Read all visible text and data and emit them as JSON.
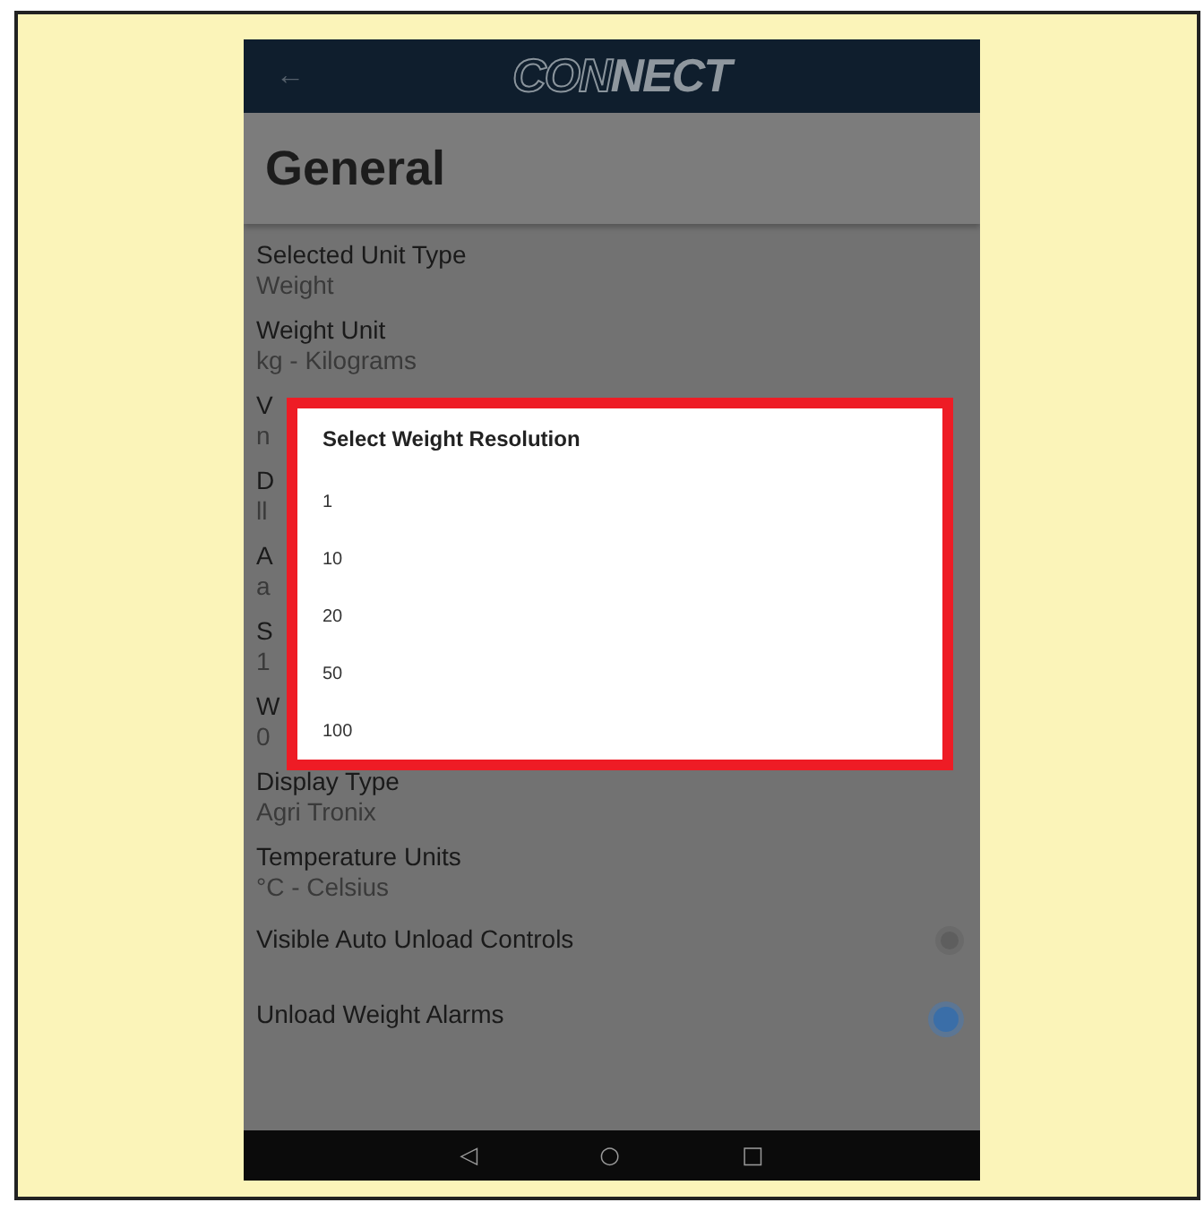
{
  "app_bar": {
    "back": "←",
    "logo": [
      {
        "text": "CON",
        "kind": "outline"
      },
      {
        "text": "NECT",
        "kind": "solid"
      }
    ]
  },
  "page_title": "General",
  "settings": [
    {
      "kind": "value",
      "title": "Selected Unit Type",
      "value": "Weight"
    },
    {
      "kind": "value",
      "title": "Weight Unit",
      "value": "kg - Kilograms"
    },
    {
      "kind": "value",
      "title": "V",
      "value": "n"
    },
    {
      "kind": "value",
      "title": "D",
      "value": "ll"
    },
    {
      "kind": "value",
      "title": "A",
      "value": "a"
    },
    {
      "kind": "value",
      "title": "S",
      "value": "1"
    },
    {
      "kind": "value",
      "title": "W",
      "value": "0"
    },
    {
      "kind": "value",
      "title": "Display Type",
      "value": "Agri Tronix"
    },
    {
      "kind": "value",
      "title": "Temperature Units",
      "value": "°C - Celsius"
    },
    {
      "kind": "switch",
      "title": "Visible Auto Unload Controls",
      "on": false
    },
    {
      "kind": "switch",
      "title": "Unload Weight Alarms",
      "on": true
    }
  ],
  "dialog": {
    "title": "Select Weight Resolution",
    "options": [
      "1",
      "10",
      "20",
      "50",
      "100"
    ]
  },
  "nav_bar": {
    "back": "◁",
    "home": "○",
    "recents": "□"
  }
}
